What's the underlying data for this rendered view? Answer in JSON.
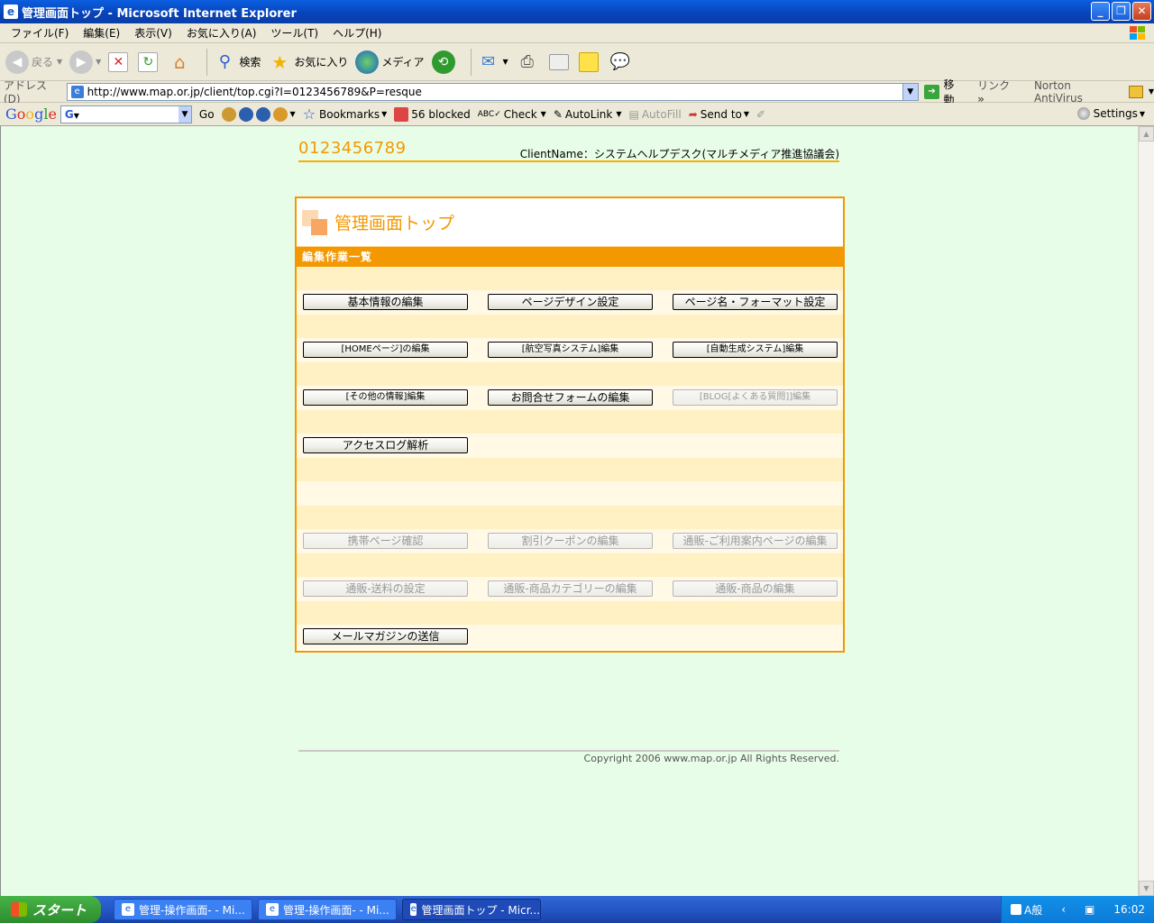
{
  "window": {
    "title": "管理画面トップ - Microsoft Internet Explorer",
    "controls": [
      "_",
      "❐",
      "✕"
    ]
  },
  "menu": [
    "ファイル(F)",
    "編集(E)",
    "表示(V)",
    "お気に入り(A)",
    "ツール(T)",
    "ヘルプ(H)"
  ],
  "toolbar": {
    "back": "戻る",
    "search": "検索",
    "favorites": "お気に入り",
    "media": "メディア"
  },
  "address": {
    "label": "アドレス(D)",
    "url": "http://www.map.or.jp/client/top.cgi?I=0123456789&P=resque",
    "go": "移動",
    "links": "リンク",
    "norton": "Norton AntiVirus"
  },
  "google": {
    "go": "Go",
    "bookmarks": "Bookmarks",
    "blocked": "56 blocked",
    "check": "Check",
    "autolink": "AutoLink",
    "autofill": "AutoFill",
    "sendto": "Send to",
    "settings": "Settings"
  },
  "page": {
    "client_id": "0123456789",
    "client_name": "ClientName：システムヘルプデスク(マルチメディア推進協議会)",
    "panel_title": "管理画面トップ",
    "section": "編集作業一覧",
    "rows": [
      [
        {
          "label": "基本情報の編集",
          "enabled": true,
          "small": false
        },
        {
          "label": "ページデザイン設定",
          "enabled": true,
          "small": false
        },
        {
          "label": "ページ名・フォーマット設定",
          "enabled": true,
          "small": false
        }
      ],
      [
        {
          "label": "[HOMEページ]の編集",
          "enabled": true,
          "small": true
        },
        {
          "label": "[航空写真システム]編集",
          "enabled": true,
          "small": true
        },
        {
          "label": "[自動生成システム]編集",
          "enabled": true,
          "small": true
        }
      ],
      [
        {
          "label": "[その他の情報]編集",
          "enabled": true,
          "small": true
        },
        {
          "label": "お問合せフォームの編集",
          "enabled": true,
          "small": false
        },
        {
          "label": "[BLOG[よくある質問]]編集",
          "enabled": false,
          "small": true
        }
      ],
      [
        {
          "label": "アクセスログ解析",
          "enabled": true,
          "small": false
        }
      ],
      [],
      [
        {
          "label": "携帯ページ確認",
          "enabled": false,
          "small": false
        },
        {
          "label": "割引クーポンの編集",
          "enabled": false,
          "small": false
        },
        {
          "label": "通販-ご利用案内ページの編集",
          "enabled": false,
          "small": false
        }
      ],
      [
        {
          "label": "通販-送料の設定",
          "enabled": false,
          "small": false
        },
        {
          "label": "通販-商品カテゴリーの編集",
          "enabled": false,
          "small": false
        },
        {
          "label": "通販-商品の編集",
          "enabled": false,
          "small": false
        }
      ],
      [
        {
          "label": "メールマガジンの送信",
          "enabled": true,
          "small": false
        }
      ]
    ],
    "copyright": "Copyright 2006 www.map.or.jp All Rights Reserved."
  },
  "taskbar": {
    "start": "スタート",
    "tasks": [
      {
        "label": "管理-操作画面- - Mi...",
        "active": false
      },
      {
        "label": "管理-操作画面- - Mi...",
        "active": false
      },
      {
        "label": "管理画面トップ - Micr...",
        "active": true
      }
    ],
    "tray_text": "A般",
    "clock": "16:02"
  }
}
